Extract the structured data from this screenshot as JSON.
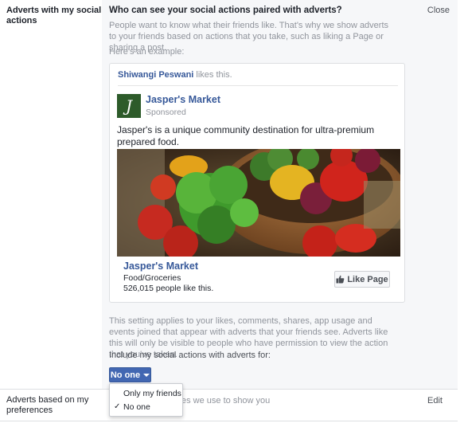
{
  "social_actions": {
    "label": "Adverts with my social actions",
    "question": "Who can see your social actions paired with adverts?",
    "close_label": "Close",
    "description": "People want to know what their friends like. That's why we show adverts to your friends based on actions that you take, such as liking a Page or sharing a post.",
    "example_label": "Here's an example:",
    "applies_text": "This setting applies to your likes, comments, shares, app usage and events joined that appear with adverts that your friends see. Adverts like this will only be visible to people who have permission to view the action that you've taken.",
    "include_label": "Include my social actions with adverts for:",
    "audience_button": "No one",
    "dropdown_options": [
      {
        "label": "Only my friends",
        "checked": false
      },
      {
        "label": "No one",
        "checked": true
      }
    ],
    "check_mark": "✓"
  },
  "example_ad": {
    "friend_name": "Shiwangi Peswani",
    "friend_action": "likes this.",
    "page_logo_letter": "J",
    "page_name": "Jasper's Market",
    "sponsored_label": "Sponsored",
    "ad_text": "Jasper's is a unique community destination for ultra-premium prepared food.",
    "image_icon": "vegetables-bowl-photo",
    "footer_name": "Jasper's Market",
    "footer_category": "Food/Groceries",
    "footer_likes": "526,015 people like this.",
    "like_page_label": "Like Page"
  },
  "preferences": {
    "label": "Adverts based on my preferences",
    "description_visible": "es we use to show you",
    "edit_label": "Edit"
  },
  "colors": {
    "brand_blue": "#4267b2",
    "link_blue": "#365899",
    "muted_text": "#90949c",
    "panel_bg": "#f6f7f9",
    "logo_green": "#2d5b2a"
  }
}
